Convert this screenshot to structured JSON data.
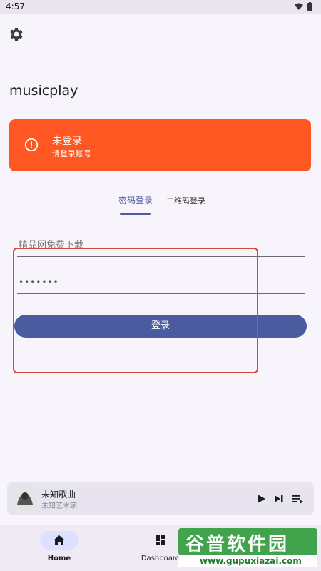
{
  "status_bar": {
    "time": "4:57"
  },
  "app": {
    "title": "musicplay"
  },
  "login_card": {
    "title": "未登录",
    "subtitle": "请登录账号"
  },
  "tabs": [
    {
      "label": "密码登录",
      "active": true
    },
    {
      "label": "二维码登录",
      "active": false
    }
  ],
  "form": {
    "username_placeholder": "精品网免费下载",
    "password_value": "•••••••",
    "login_label": "登录"
  },
  "mini_player": {
    "song": "未知歌曲",
    "artist": "未知艺术家"
  },
  "bottom_nav": [
    {
      "label": "Home",
      "icon": "home-icon",
      "active": true
    },
    {
      "label": "Dashboard",
      "icon": "dashboard-icon",
      "active": false
    }
  ],
  "watermark": {
    "text": "谷普软件园",
    "url_text": "www.gupuxiazai.com"
  },
  "colors": {
    "accent": "#4a5ba0",
    "warning": "#ff5722",
    "highlight": "#d24b3e"
  }
}
